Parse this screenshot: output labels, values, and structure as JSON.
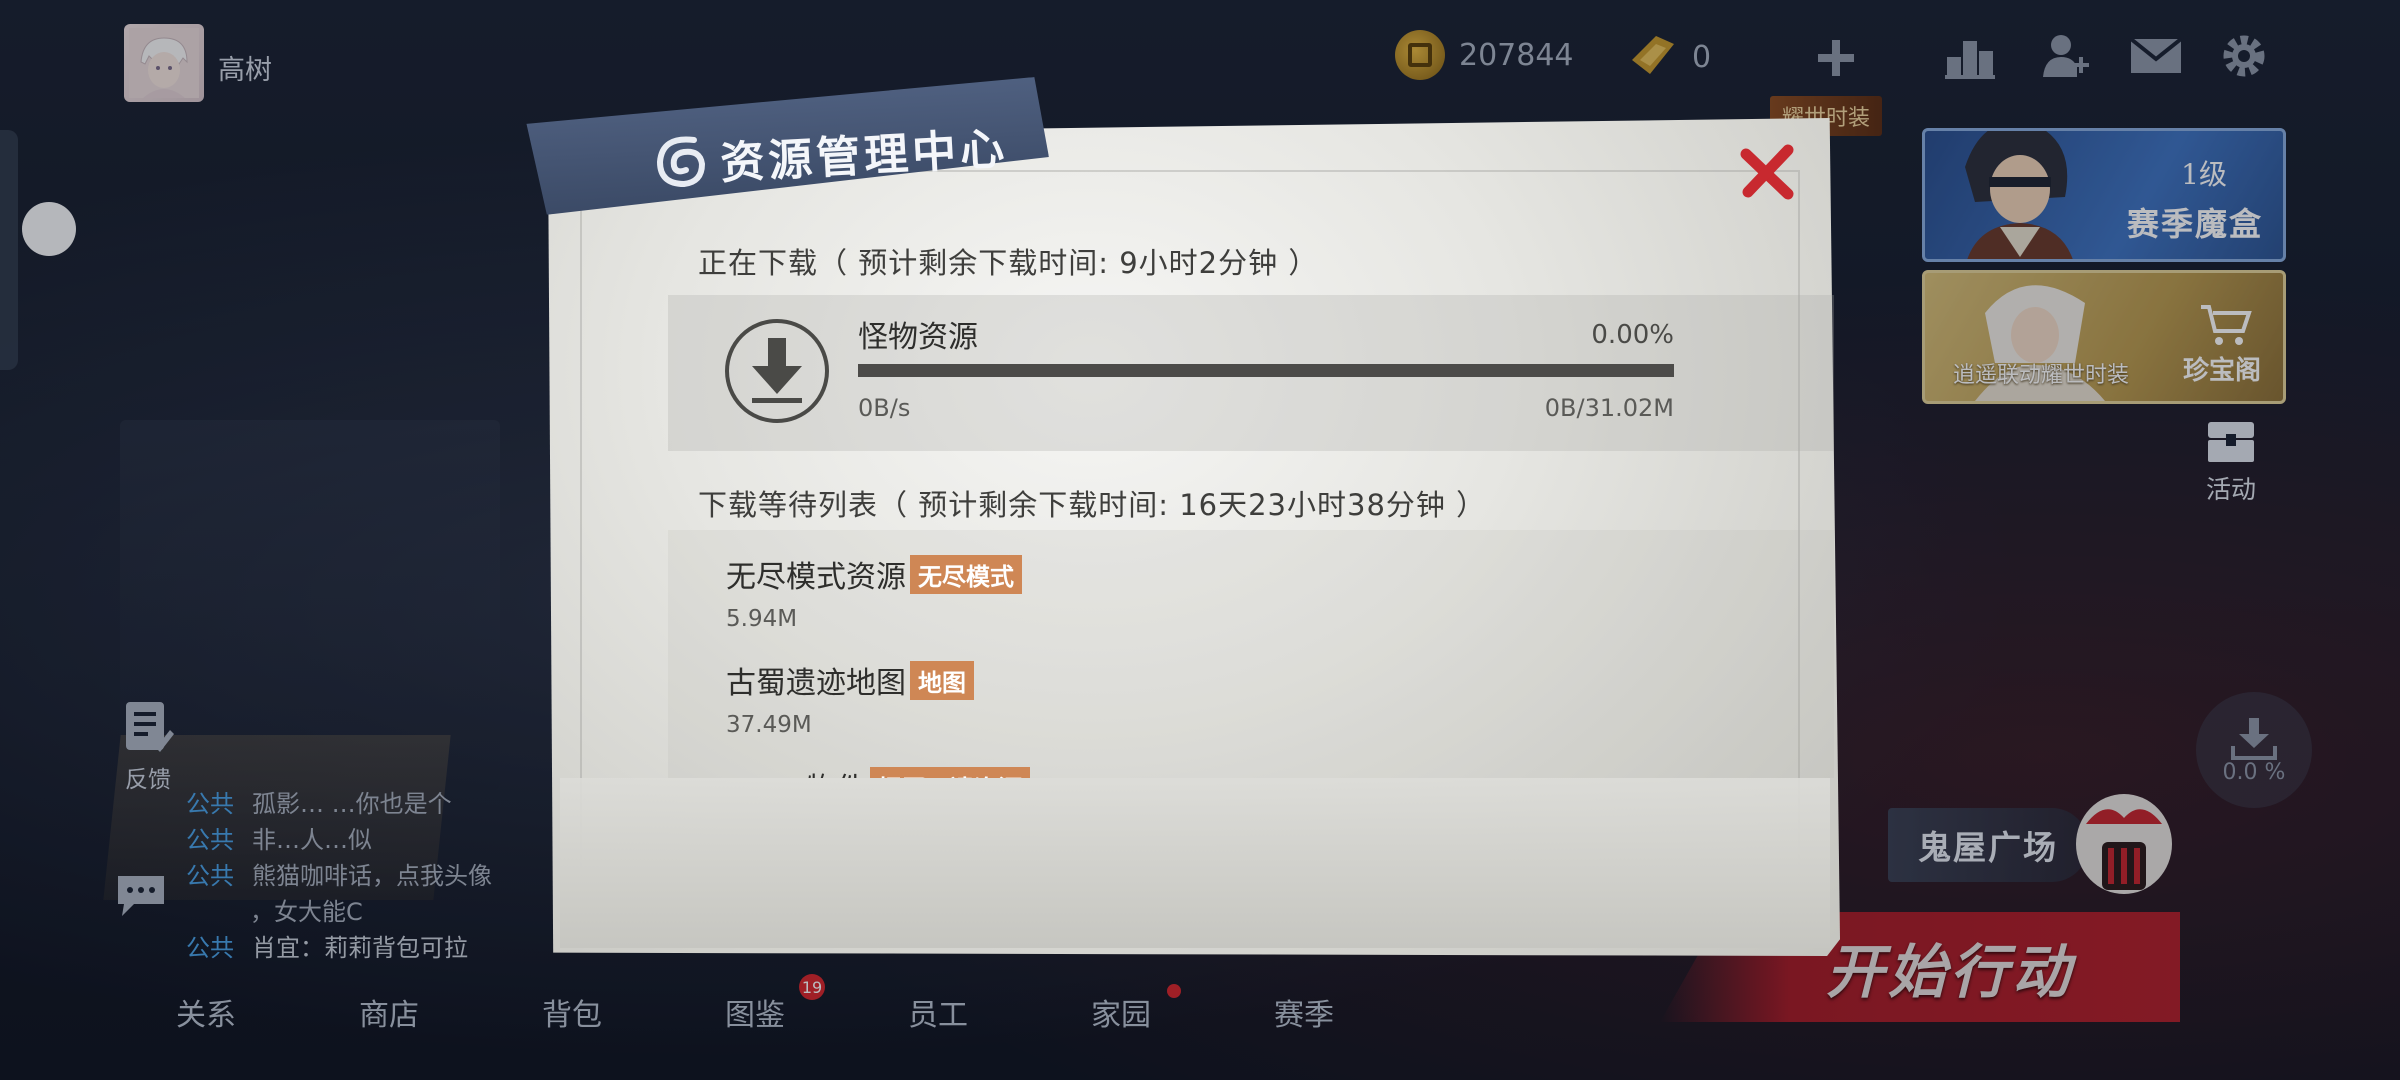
{
  "player": {
    "name": "高树"
  },
  "resources": {
    "coins": "207844",
    "gems": "0"
  },
  "right_panel": {
    "glory_tag": "耀世时装",
    "season_level": "1级",
    "season_title": "赛季魔盒",
    "treasure_title": "珍宝阁",
    "treasure_sub": "逍遥联动耀世时装",
    "activity_label": "活动",
    "download_pct": "0.0 %",
    "ghost_house": "鬼屋广场",
    "start_button": "开始行动"
  },
  "left_panel": {
    "feedback_label": "反馈",
    "chat": [
      {
        "channel": "公共",
        "text": "孤影…   …你也是个"
      },
      {
        "channel": "公共",
        "text": "非…人…似"
      },
      {
        "channel": "公共",
        "text": "熊猫咖啡话，点我头像"
      },
      {
        "channel": "",
        "text": "，女大能C"
      },
      {
        "channel": "公共",
        "text": "肖宜：莉莉背包可拉"
      }
    ]
  },
  "bottom_nav": [
    {
      "label": "关系",
      "badge": ""
    },
    {
      "label": "商店",
      "badge": ""
    },
    {
      "label": "背包",
      "badge": ""
    },
    {
      "label": "图鉴",
      "badge": "19"
    },
    {
      "label": "员工",
      "badge": ""
    },
    {
      "label": "家园",
      "badge": "dot"
    },
    {
      "label": "赛季",
      "badge": ""
    }
  ],
  "modal": {
    "title": "资源管理中心",
    "downloading_label": "正在下载（ 预计剩余下载时间: 9小时2分钟 ）",
    "current": {
      "name": "怪物资源",
      "progress_pct_text": "0.00%",
      "progress": 0.0,
      "speed": "0B/s",
      "size": "0B/31.02M"
    },
    "queue_label": "下载等待列表（ 预计剩余下载时间: 16天23小时38分钟 ）",
    "queue": [
      {
        "name": "无尽模式资源",
        "tag": "无尽模式",
        "size": "5.94M"
      },
      {
        "name": "古蜀遗迹地图",
        "tag": "地图",
        "size": "37.49M"
      },
      {
        "name": "…物件",
        "tag": "扭蛋…遗资源",
        "size": ""
      }
    ]
  },
  "colors": {
    "tag_orange": "#cf8755",
    "close_red": "#c8292f",
    "chat_channel": "#4aa2e8"
  }
}
